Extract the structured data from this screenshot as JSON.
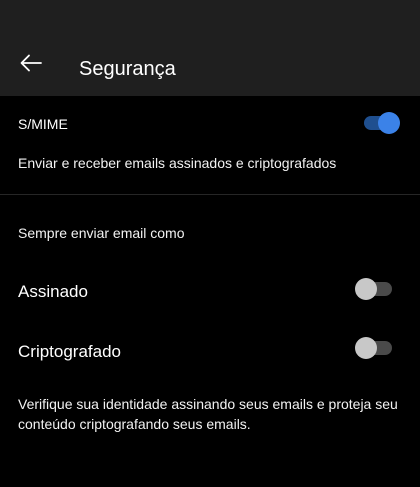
{
  "header": {
    "title": "Segurança",
    "back_icon": "arrow-left-icon"
  },
  "smime": {
    "label": "S/MIME",
    "enabled": true,
    "description": "Enviar e receber emails assinados e criptografados"
  },
  "always_send": {
    "header": "Sempre enviar email como",
    "options": [
      {
        "label": "Assinado",
        "enabled": false
      },
      {
        "label": "Criptografado",
        "enabled": false
      }
    ]
  },
  "footer": {
    "text": "Verifique sua identidade assinando seus emails e proteja seu conteúdo criptografando seus emails."
  },
  "colors": {
    "background": "#000000",
    "header_background": "#1f1f1f",
    "toggle_on_track": "#1f4f8f",
    "toggle_on_knob": "#3b82e8",
    "toggle_off_track": "#4a4a4a",
    "toggle_off_knob": "#c8c8c8"
  }
}
